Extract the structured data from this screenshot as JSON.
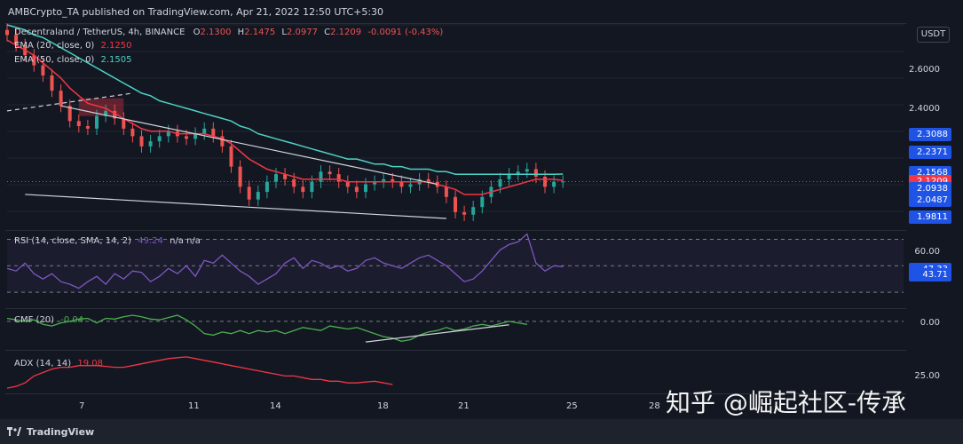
{
  "header": {
    "published": "AMBCrypto_TA published on TradingView.com, Apr 21, 2022 12:50 UTC+5:30"
  },
  "legend": {
    "symbol": "Decentraland / TetherUS, 4h, BINANCE",
    "open_label": "O",
    "open": "2.1300",
    "high_label": "H",
    "high": "2.1475",
    "low_label": "L",
    "low": "2.0977",
    "close_label": "C",
    "close": "2.1209",
    "change": "-0.0091 (-0.43%)",
    "ema20_label": "EMA (20, close, 0)",
    "ema20_value": "2.1250",
    "ema50_label": "EMA (50, close, 0)",
    "ema50_value": "2.1505",
    "rsi_label": "RSI (14, close, SMA, 14, 2)",
    "rsi_value": "49.24",
    "rsi_extra": "n/a n/a",
    "cmf_label": "CMF (20)",
    "cmf_value": "-0.04",
    "adx_label": "ADX (14, 14)",
    "adx_value": "19.08"
  },
  "currency_button": "USDT",
  "axis": {
    "price_tick_top": "2.6000",
    "price_tick_covered": "2.4000",
    "rsi_tick": "60.00",
    "cmf_tick": "0.00",
    "adx_tick": "25.00"
  },
  "price_badges": [
    {
      "value": "2.3088",
      "color": "#1e53e5"
    },
    {
      "value": "2.2371",
      "color": "#1e53e5"
    },
    {
      "value": "2.1568",
      "color": "#1e53e5"
    },
    {
      "value": "2.1229",
      "color": "#1e53e5"
    },
    {
      "value": "2.1209",
      "color": "#f23645"
    },
    {
      "value": "2.0938",
      "color": "#1e53e5"
    },
    {
      "value": "2.0487",
      "color": "#1e53e5"
    },
    {
      "value": "1.9811",
      "color": "#1e53e5"
    }
  ],
  "rsi_badges": [
    {
      "value": "47.33",
      "color": "#1e53e5"
    },
    {
      "value": "43.71",
      "color": "#1e53e5"
    }
  ],
  "x_labels": [
    "7",
    "11",
    "14",
    "18",
    "21",
    "25",
    "28"
  ],
  "footer": {
    "brand": "TradingView"
  },
  "watermark": "知乎 @崛起社区-传承",
  "colors": {
    "background": "#131722",
    "candle_up": "#26a69a",
    "candle_down": "#ef5350",
    "ema20": "#f23645",
    "ema50": "#4dd0c4",
    "rsi": "#7e57c2",
    "cmf": "#4caf50",
    "adx": "#f23645",
    "trendline": "#d1d4dc"
  },
  "chart_data": [
    {
      "type": "candlestick",
      "title": "Decentraland / TetherUS, 4h, BINANCE",
      "x_ticks": [
        "7",
        "11",
        "14",
        "18",
        "21",
        "25",
        "28"
      ],
      "y_ticks": [
        2.6,
        2.4
      ],
      "last_price": 2.1209,
      "ohlc_last": {
        "open": 2.13,
        "high": 2.1475,
        "low": 2.0977,
        "close": 2.1209
      },
      "price_series": [
        2.7,
        2.66,
        2.62,
        2.58,
        2.54,
        2.48,
        2.42,
        2.36,
        2.34,
        2.33,
        2.38,
        2.4,
        2.37,
        2.33,
        2.3,
        2.26,
        2.28,
        2.3,
        2.32,
        2.3,
        2.29,
        2.31,
        2.33,
        2.3,
        2.26,
        2.18,
        2.1,
        2.05,
        2.08,
        2.12,
        2.15,
        2.13,
        2.1,
        2.08,
        2.12,
        2.16,
        2.15,
        2.12,
        2.1,
        2.08,
        2.11,
        2.12,
        2.13,
        2.12,
        2.1,
        2.11,
        2.13,
        2.12,
        2.1,
        2.06,
        2.0,
        1.99,
        2.02,
        2.06,
        2.1,
        2.13,
        2.15,
        2.16,
        2.17,
        2.14,
        2.1,
        2.12,
        2.1209
      ],
      "ema20_series": [
        2.68,
        2.66,
        2.64,
        2.62,
        2.59,
        2.56,
        2.53,
        2.49,
        2.46,
        2.43,
        2.42,
        2.41,
        2.39,
        2.37,
        2.35,
        2.33,
        2.32,
        2.32,
        2.32,
        2.31,
        2.31,
        2.31,
        2.31,
        2.3,
        2.29,
        2.27,
        2.24,
        2.21,
        2.19,
        2.17,
        2.16,
        2.15,
        2.14,
        2.13,
        2.13,
        2.13,
        2.13,
        2.13,
        2.12,
        2.12,
        2.12,
        2.12,
        2.12,
        2.12,
        2.12,
        2.12,
        2.12,
        2.12,
        2.11,
        2.1,
        2.09,
        2.07,
        2.07,
        2.07,
        2.08,
        2.09,
        2.1,
        2.11,
        2.12,
        2.13,
        2.13,
        2.13,
        2.125
      ],
      "ema50_series": [
        2.74,
        2.73,
        2.72,
        2.7,
        2.69,
        2.67,
        2.65,
        2.63,
        2.61,
        2.59,
        2.57,
        2.55,
        2.53,
        2.51,
        2.49,
        2.47,
        2.46,
        2.44,
        2.43,
        2.42,
        2.41,
        2.4,
        2.39,
        2.38,
        2.37,
        2.36,
        2.34,
        2.33,
        2.31,
        2.3,
        2.29,
        2.28,
        2.27,
        2.26,
        2.25,
        2.24,
        2.23,
        2.22,
        2.21,
        2.21,
        2.2,
        2.19,
        2.19,
        2.18,
        2.18,
        2.17,
        2.17,
        2.17,
        2.16,
        2.16,
        2.15,
        2.15,
        2.15,
        2.15,
        2.15,
        2.15,
        2.15,
        2.15,
        2.15,
        2.15,
        2.15,
        2.15,
        2.1505
      ],
      "ylim": [
        1.94,
        2.74
      ],
      "x_domain": [
        0,
        100
      ],
      "candle_x_range": [
        0,
        62
      ],
      "trendlines": [
        {
          "points": [
            [
              0,
              2.4
            ],
            [
              14,
              2.47
            ]
          ],
          "style": "dashed"
        },
        {
          "points": [
            [
              2,
              2.07
            ],
            [
              49,
              1.975
            ]
          ],
          "style": "solid"
        },
        {
          "points": [
            [
              6,
              2.42
            ],
            [
              48,
              2.11
            ]
          ],
          "style": "solid"
        }
      ]
    },
    {
      "type": "line",
      "title": "RSI (14, close, SMA, 14, 2)",
      "ylim": [
        20,
        75
      ],
      "y_ticks": [
        60
      ],
      "bands": [
        70,
        50,
        30
      ],
      "values": [
        48,
        46,
        52,
        44,
        40,
        44,
        38,
        36,
        33,
        38,
        42,
        36,
        44,
        40,
        46,
        45,
        38,
        42,
        48,
        44,
        50,
        42,
        54,
        52,
        58,
        52,
        46,
        42,
        36,
        40,
        44,
        52,
        56,
        48,
        54,
        52,
        48,
        50,
        46,
        48,
        54,
        56,
        52,
        50,
        48,
        52,
        56,
        58,
        54,
        50,
        44,
        38,
        40,
        46,
        54,
        62,
        66,
        68,
        74,
        52,
        46,
        50,
        49.24
      ],
      "x_domain": [
        0,
        100
      ],
      "x_range": [
        0,
        62
      ]
    },
    {
      "type": "line",
      "title": "CMF (20)",
      "ylim": [
        -0.35,
        0.15
      ],
      "y_ticks": [
        0.0
      ],
      "baseline": 0.0,
      "values": [
        0.04,
        0.02,
        0.0,
        0.02,
        -0.04,
        -0.06,
        -0.02,
        0.0,
        0.03,
        0.04,
        -0.02,
        0.04,
        0.03,
        0.06,
        0.08,
        0.06,
        0.03,
        0.02,
        0.05,
        0.08,
        0.02,
        -0.06,
        -0.16,
        -0.18,
        -0.14,
        -0.16,
        -0.12,
        -0.16,
        -0.12,
        -0.14,
        -0.12,
        -0.16,
        -0.12,
        -0.08,
        -0.1,
        -0.12,
        -0.06,
        -0.08,
        -0.1,
        -0.08,
        -0.12,
        -0.16,
        -0.2,
        -0.22,
        -0.26,
        -0.24,
        -0.18,
        -0.14,
        -0.12,
        -0.08,
        -0.12,
        -0.1,
        -0.06,
        -0.04,
        -0.06,
        -0.03,
        0.0,
        -0.02,
        -0.04
      ],
      "x_domain": [
        0,
        100
      ],
      "x_range": [
        0,
        58
      ],
      "trendline": {
        "points": [
          [
            40,
            -0.27
          ],
          [
            56,
            -0.045
          ]
        ]
      }
    },
    {
      "type": "line",
      "title": "ADX (14, 14)",
      "ylim": [
        15,
        38
      ],
      "y_ticks": [
        25
      ],
      "values": [
        17,
        18,
        20,
        24,
        26,
        28,
        29,
        29,
        30,
        30,
        30,
        29.5,
        29,
        29,
        30,
        31,
        32,
        33,
        34,
        34.5,
        35,
        34,
        33,
        32,
        31,
        30,
        29,
        28,
        27,
        26,
        25,
        24,
        24,
        23,
        22,
        22,
        21,
        21,
        20,
        20,
        20.5,
        21,
        20,
        19.08
      ],
      "x_domain": [
        0,
        100
      ],
      "x_range": [
        0,
        43
      ]
    }
  ]
}
